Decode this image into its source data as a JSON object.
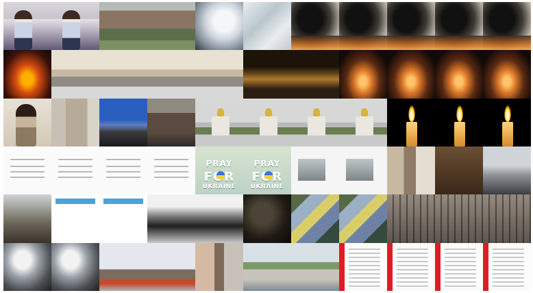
{
  "mosaic": {
    "columns": 11,
    "rows": 6,
    "tiles": [
      "girl",
      "girl",
      "building",
      "building",
      "blur",
      "blur2",
      "fire",
      "fire",
      "fire",
      "fire",
      "fire",
      "burn",
      "street",
      "street",
      "street",
      "street",
      "night",
      "night",
      "nightfire",
      "nightfire",
      "nightfire",
      "nightfire",
      "woman",
      "tower",
      "sky",
      "group",
      "church",
      "church",
      "church",
      "church",
      "candle",
      "candle",
      "candle",
      "doc",
      "doc",
      "doc",
      "doc",
      "pray",
      "pray",
      "chat",
      "chat",
      "ruin",
      "crowd",
      "snow",
      "trees",
      "tweet",
      "tweet",
      "bw",
      "bw",
      "dark",
      "camo",
      "camo",
      "facade",
      "facade",
      "facade",
      "smoke",
      "smoke",
      "market",
      "market",
      "canyon",
      "city",
      "city",
      "list",
      "list",
      "list",
      "list"
    ],
    "pray_for_ukraine": {
      "line1": "PRAY",
      "line2": "FOR",
      "line3": "UKRAINE"
    }
  }
}
